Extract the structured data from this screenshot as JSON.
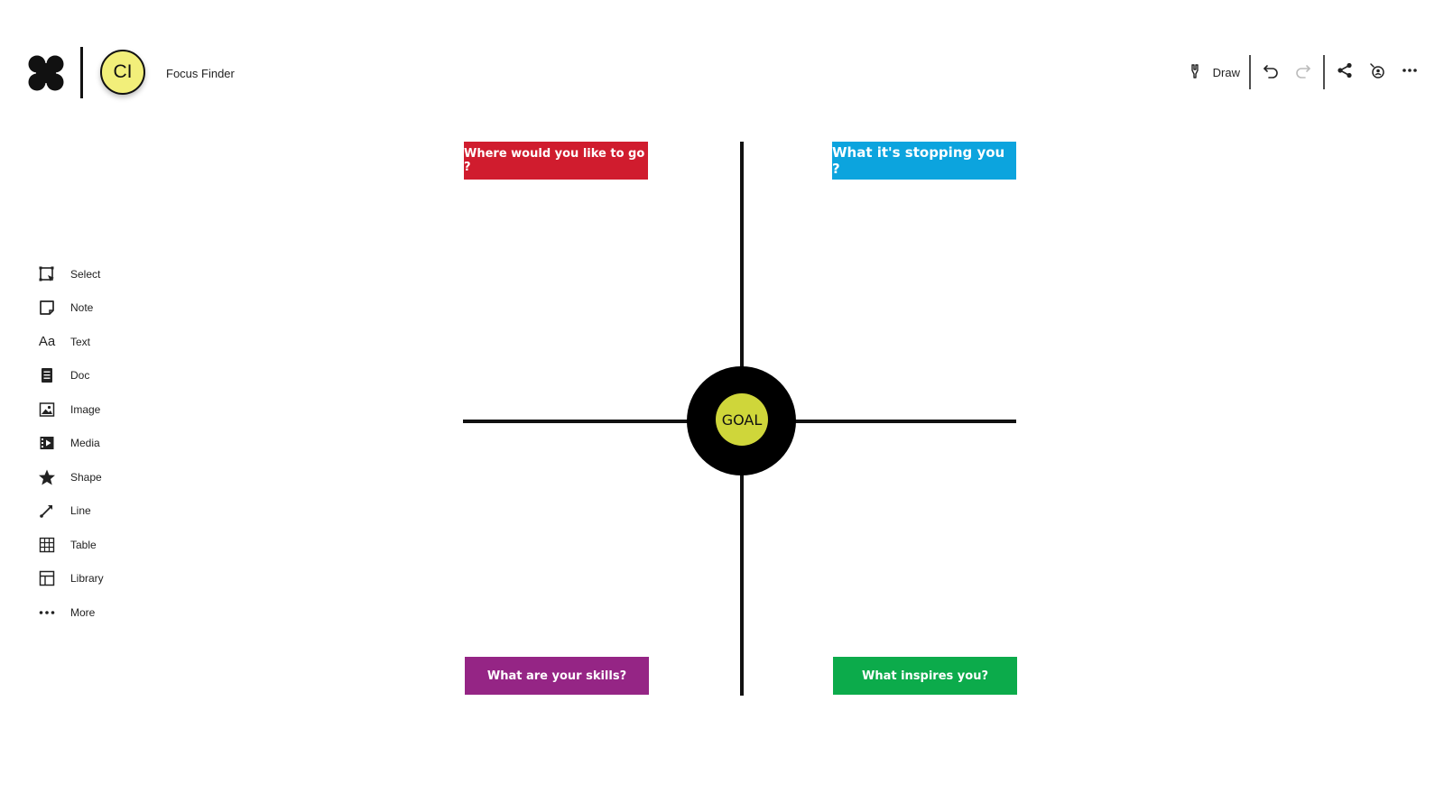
{
  "header": {
    "avatar_initials": "CI",
    "board_title": "Focus Finder"
  },
  "toolbar": {
    "draw_label": "Draw",
    "items": [
      {
        "name": "draw",
        "icon": "pen-icon",
        "label": "Draw"
      },
      {
        "name": "undo",
        "icon": "undo-icon"
      },
      {
        "name": "redo",
        "icon": "redo-icon",
        "disabled": true
      },
      {
        "name": "share",
        "icon": "share-icon"
      },
      {
        "name": "collaborate",
        "icon": "presence-icon"
      },
      {
        "name": "more",
        "icon": "more-horizontal-icon"
      }
    ]
  },
  "rail": {
    "items": [
      {
        "label": "Select",
        "icon": "select-icon"
      },
      {
        "label": "Note",
        "icon": "note-icon"
      },
      {
        "label": "Text",
        "icon": "text-icon",
        "glyph": "Aa"
      },
      {
        "label": "Doc",
        "icon": "doc-icon"
      },
      {
        "label": "Image",
        "icon": "image-icon"
      },
      {
        "label": "Media",
        "icon": "media-icon"
      },
      {
        "label": "Shape",
        "icon": "star-icon"
      },
      {
        "label": "Line",
        "icon": "line-icon"
      },
      {
        "label": "Table",
        "icon": "table-icon"
      },
      {
        "label": "Library",
        "icon": "library-icon"
      },
      {
        "label": "More",
        "icon": "more-horizontal-icon"
      }
    ]
  },
  "diagram": {
    "center_label": "GOAL",
    "center_color": "#cfd63a",
    "notes": {
      "top_left": {
        "text": "Where would you like to go ?",
        "color": "#d01c2e"
      },
      "top_right": {
        "text": "What it's stopping you ?",
        "color": "#0ca4de"
      },
      "bottom_left": {
        "text": "What are your skills?",
        "color": "#952585"
      },
      "bottom_right": {
        "text": "What inspires you?",
        "color": "#0cab4b"
      }
    }
  }
}
